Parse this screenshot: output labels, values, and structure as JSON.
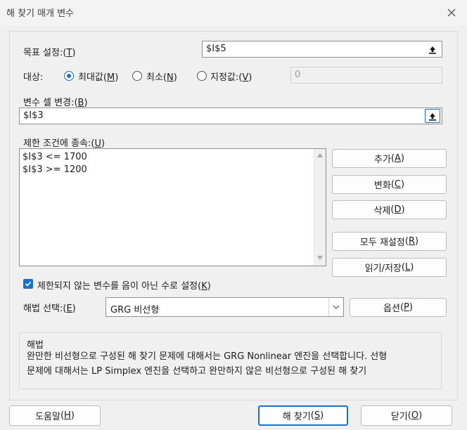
{
  "window": {
    "title": "해 찾기 매개 변수"
  },
  "objective": {
    "label": "목표 설정:",
    "hotkey": "T",
    "value": "$I$5"
  },
  "target": {
    "label": "대상:",
    "options": [
      {
        "label": "최대값",
        "hotkey": "M",
        "selected": true
      },
      {
        "label": "최소",
        "hotkey": "N",
        "selected": false
      },
      {
        "label": "지정값:",
        "hotkey": "V",
        "selected": false
      }
    ],
    "value_of": "0"
  },
  "changing": {
    "label": "변수 셀 변경:",
    "hotkey": "B",
    "value": "$I$3"
  },
  "constraints": {
    "label": "제한 조건에 종속:",
    "hotkey": "U",
    "items": [
      "$I$3 <= 1700",
      "$I$3 >= 1200"
    ]
  },
  "buttons": {
    "add": {
      "label": "추가",
      "hotkey": "A"
    },
    "change": {
      "label": "변화",
      "hotkey": "C"
    },
    "delete": {
      "label": "삭제",
      "hotkey": "D"
    },
    "reset": {
      "label": "모두 재설정",
      "hotkey": "R"
    },
    "loadsave": {
      "label": "읽기/저장",
      "hotkey": "L"
    },
    "options": {
      "label": "옵션",
      "hotkey": "P"
    },
    "help": {
      "label": "도움말",
      "hotkey": "H"
    },
    "solve": {
      "label": "해 찾기",
      "hotkey": "S"
    },
    "close": {
      "label": "닫기",
      "hotkey": "O"
    }
  },
  "nonneg": {
    "label": "제한되지 않는 변수를 음이 아닌 수로 설정",
    "hotkey": "K",
    "checked": true
  },
  "method": {
    "label": "해법 선택:",
    "hotkey": "E",
    "value": "GRG 비선형"
  },
  "solving": {
    "title": "해법",
    "line1": "완만한 비선형으로 구성된 해 찾기 문제에 대해서는 GRG Nonlinear 엔진을 선택합니다. 선형",
    "line2": "문제에 대해서는 LP Simplex 엔진을 선택하고 완만하지 않은 비선형으로 구성된 해 찾기"
  }
}
